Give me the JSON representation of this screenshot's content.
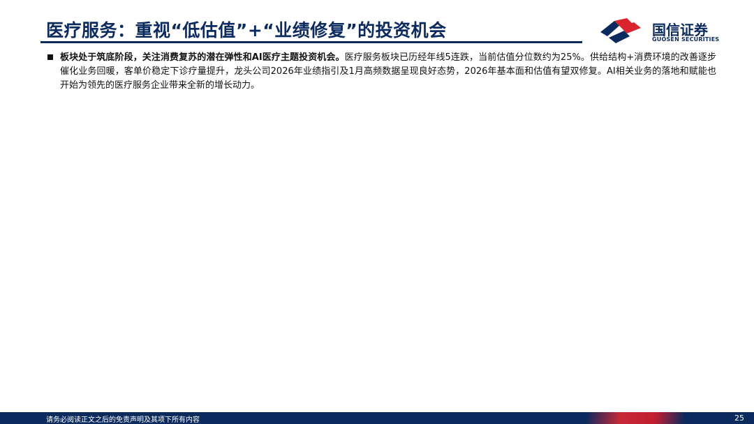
{
  "header": {
    "title": "医疗服务：重视“低估值”+“业绩修复”的投资机会",
    "logo_cn": "国信证券",
    "logo_en": "GUOSEN SECURITIES"
  },
  "content": {
    "bullet_lead": "板块处于筑底阶段，关注消费复苏的潜在弹性和AI医疗主题投资机会。",
    "bullet_body": "医疗服务板块已历经年线5连跌，当前估值分位数约为25%。供给结构+消费环境的改善逐步催化业务回暖，客单价稳定下诊疗量提升，龙头公司2026年业绩指引及1月高频数据呈现良好态势，2026年基本面和估值有望双修复。AI相关业务的落地和赋能也开始为领先的医疗服务企业带来全新的增长动力。"
  },
  "footer": {
    "disclaimer": "请务必阅读正文之后的免责声明及其项下所有内容",
    "page_number": "25"
  },
  "colors": {
    "brand_navy": "#0b2a5e",
    "brand_red": "#d9232e"
  }
}
